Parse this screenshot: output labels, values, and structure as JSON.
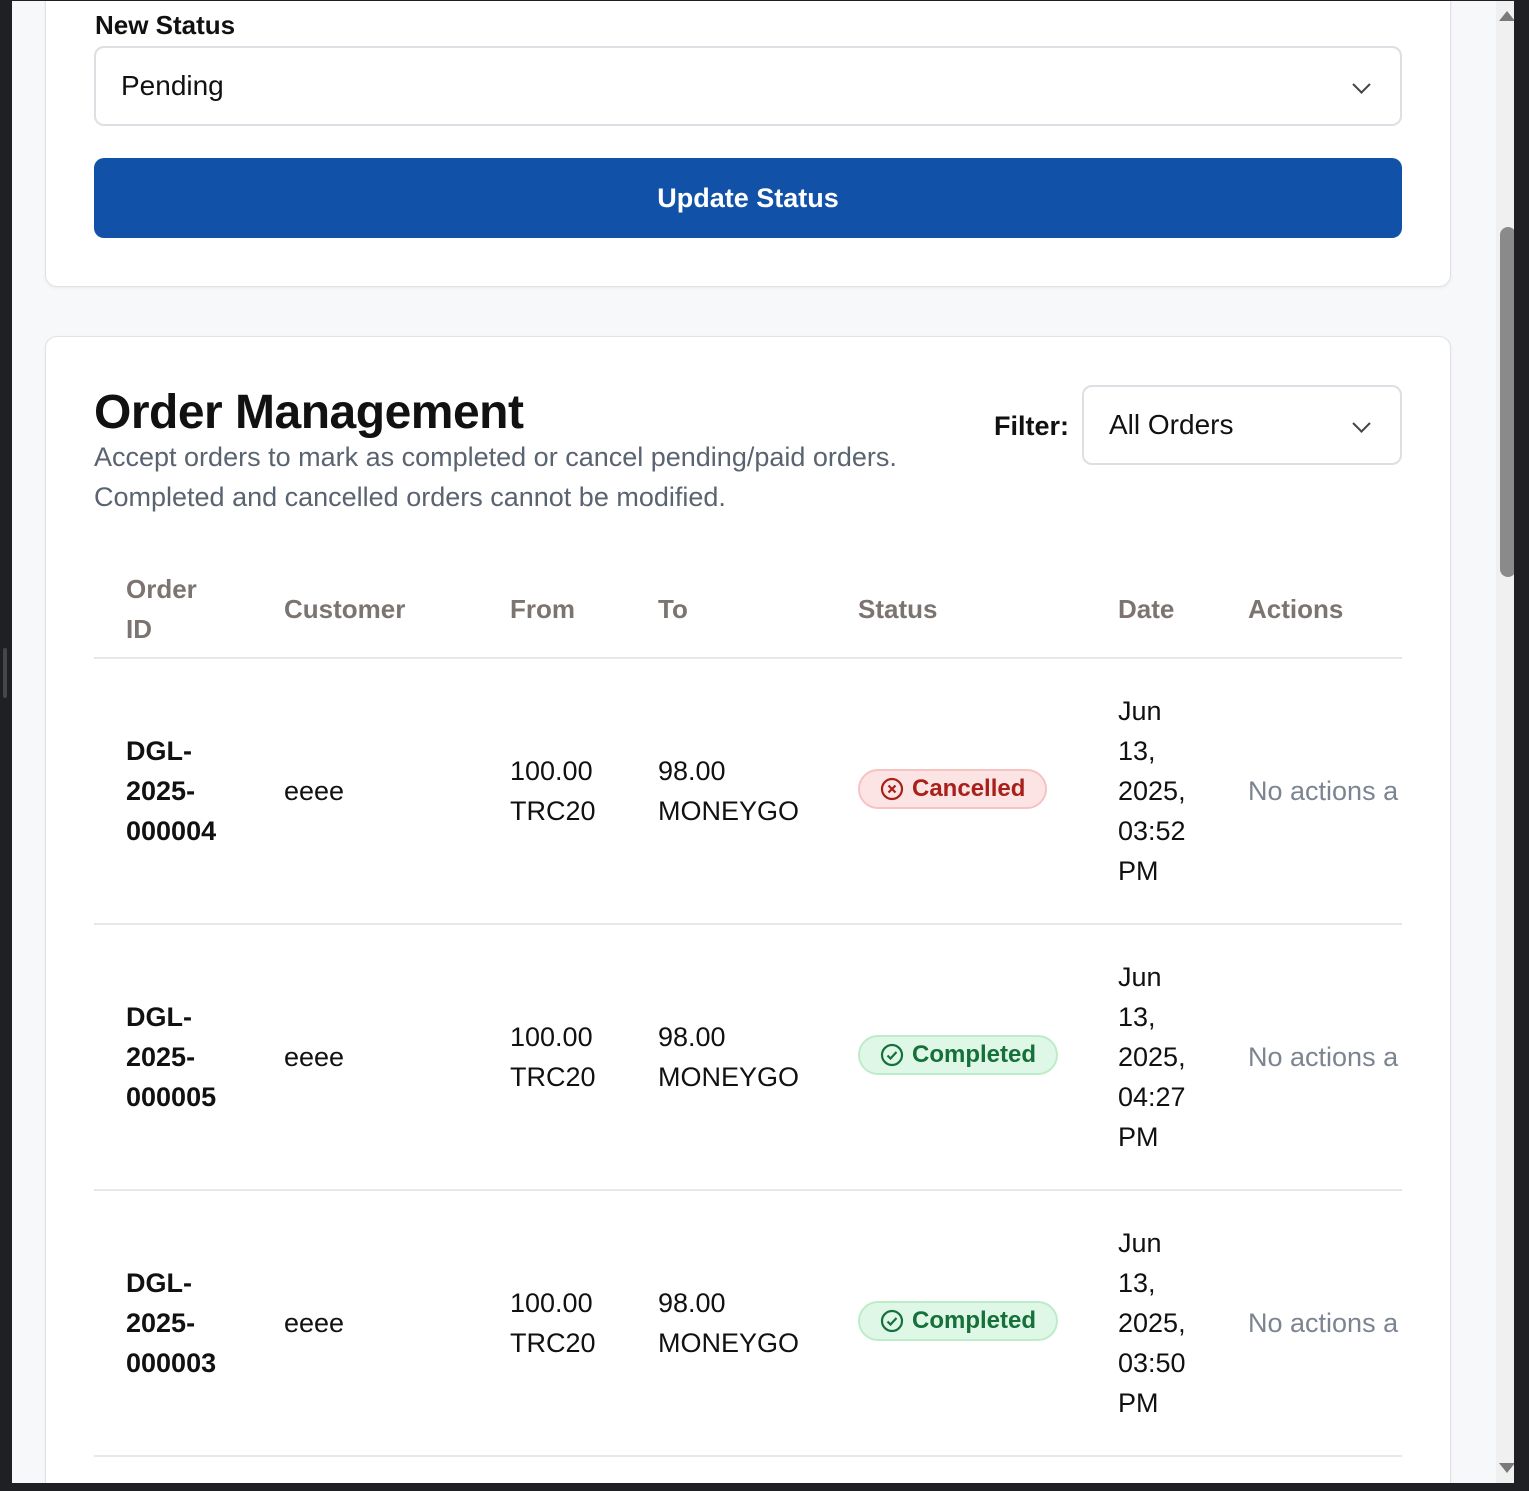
{
  "status_form": {
    "label": "New Status",
    "selected": "Pending",
    "button_label": "Update Status"
  },
  "orders": {
    "title": "Order Management",
    "description": "Accept orders to mark as completed or cancel pending/paid orders. Completed and cancelled orders cannot be modified.",
    "filter_label": "Filter:",
    "filter_selected": "All Orders",
    "columns": {
      "order_id_1": "Order",
      "order_id_2": "ID",
      "customer": "Customer",
      "from": "From",
      "to": "To",
      "status": "Status",
      "date": "Date",
      "actions": "Actions"
    },
    "rows": [
      {
        "id": [
          "DGL-",
          "2025-",
          "000004"
        ],
        "customer": "eeee",
        "from": [
          "100.00",
          "TRC20"
        ],
        "to": [
          "98.00",
          "MONEYGO"
        ],
        "status": "Cancelled",
        "date": [
          "Jun",
          "13,",
          "2025,",
          "03:52",
          "PM"
        ],
        "actions": "No actions a"
      },
      {
        "id": [
          "DGL-",
          "2025-",
          "000005"
        ],
        "customer": "eeee",
        "from": [
          "100.00",
          "TRC20"
        ],
        "to": [
          "98.00",
          "MONEYGO"
        ],
        "status": "Completed",
        "date": [
          "Jun",
          "13,",
          "2025,",
          "04:27",
          "PM"
        ],
        "actions": "No actions a"
      },
      {
        "id": [
          "DGL-",
          "2025-",
          "000003"
        ],
        "customer": "eeee",
        "from": [
          "100.00",
          "TRC20"
        ],
        "to": [
          "98.00",
          "MONEYGO"
        ],
        "status": "Completed",
        "date": [
          "Jun",
          "13,",
          "2025,",
          "03:50",
          "PM"
        ],
        "actions": "No actions a"
      }
    ]
  },
  "colors": {
    "primary": "#1152a8",
    "cancelled_bg": "#fde4e4",
    "cancelled_text": "#a8201a",
    "completed_bg": "#dff7e7",
    "completed_text": "#16703a"
  }
}
